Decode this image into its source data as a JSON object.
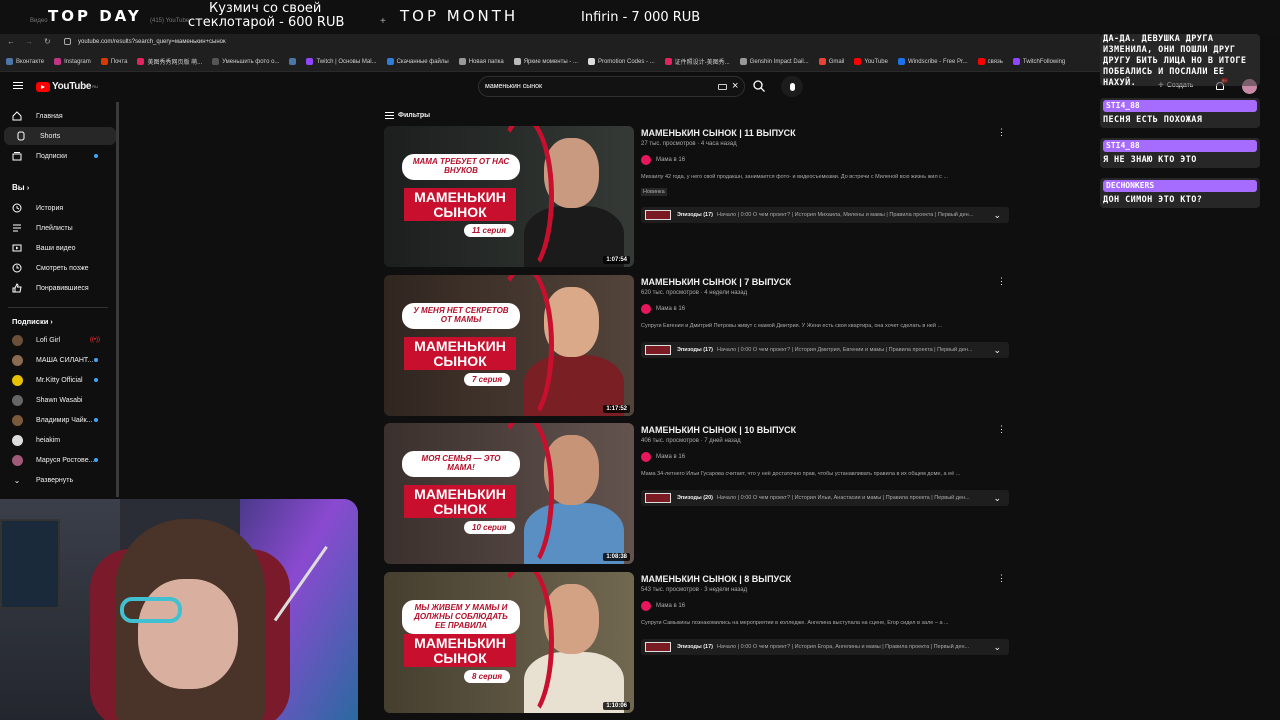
{
  "overlay": {
    "top_day": "TOP DAY",
    "donor_line1": "Кузмич со своей",
    "donor_line2": "стеклотарой - 600 RUB",
    "top_month": "TOP MONTH",
    "month_donor": "Infirin - 7 000 RUB"
  },
  "browser": {
    "tabs": [
      "Видео",
      "(415) YouTube",
      "..."
    ],
    "url": "youtube.com/results?search_query=маменькин+сынок",
    "bookmarks": [
      {
        "label": "Вконтакте",
        "color": "#4a76a8"
      },
      {
        "label": "Instagram",
        "color": "#c13584"
      },
      {
        "label": "Почта",
        "color": "#d83b01"
      },
      {
        "label": "美图秀秀网页版 萌...",
        "color": "#e0245e"
      },
      {
        "label": "Уменьшить фото о...",
        "color": "#555555"
      },
      {
        "label": "",
        "color": "#4a76a8"
      },
      {
        "label": "Twitch | Основы Маl...",
        "color": "#9146ff"
      },
      {
        "label": "Скачанные файлы",
        "color": "#2e7dd7"
      },
      {
        "label": "Новая папка",
        "color": "#999999"
      },
      {
        "label": "Яркие моменты - ...",
        "color": "#bbbbbb"
      },
      {
        "label": "Promotion Codes - ...",
        "color": "#dddddd"
      },
      {
        "label": "证件照设计-美图秀...",
        "color": "#e0245e"
      },
      {
        "label": "Genshin Impact Dail...",
        "color": "#999999"
      },
      {
        "label": "Gmail",
        "color": "#ea4335"
      },
      {
        "label": "YouTube",
        "color": "#ff0000"
      },
      {
        "label": "Windscribe - Free Pr...",
        "color": "#1a73e8"
      },
      {
        "label": "связь",
        "color": "#ff0000"
      },
      {
        "label": "TwitchFollowing",
        "color": "#9146ff"
      }
    ]
  },
  "youtube": {
    "logo": "YouTube",
    "logo_sup": "RU",
    "search_value": "маменькин сынок",
    "create_label": "Создать",
    "notif_count": "9+",
    "filters_label": "Фильтры"
  },
  "sidebar": {
    "main": [
      {
        "label": "Главная",
        "icon": "home-icon"
      },
      {
        "label": "Shorts",
        "icon": "shorts-icon"
      },
      {
        "label": "Подписки",
        "icon": "subscriptions-icon"
      }
    ],
    "you_label": "Вы",
    "you_items": [
      {
        "label": "История",
        "icon": "history-icon"
      },
      {
        "label": "Плейлисты",
        "icon": "playlists-icon"
      },
      {
        "label": "Ваши видео",
        "icon": "your-videos-icon"
      },
      {
        "label": "Смотреть позже",
        "icon": "watch-later-icon"
      },
      {
        "label": "Понравившиеся",
        "icon": "liked-icon"
      }
    ],
    "subs_label": "Подписки",
    "subs": [
      {
        "label": "Lofi Girl",
        "color": "#6b4f3a",
        "indicator": "live"
      },
      {
        "label": "МАША СИЛАНТ...",
        "color": "#8a6a50",
        "indicator": "dot"
      },
      {
        "label": "Mr.Kitty Official",
        "color": "#e6c200",
        "indicator": "dot"
      },
      {
        "label": "Shawn Wasabi",
        "color": "#666666",
        "indicator": "none"
      },
      {
        "label": "Владимир Чайк...",
        "color": "#7a5a3a",
        "indicator": "dot"
      },
      {
        "label": "heiakim",
        "color": "#dddddd",
        "indicator": "none"
      },
      {
        "label": "Маруся Ростове...",
        "color": "#a05a7a",
        "indicator": "dot"
      }
    ],
    "expand_label": "Развернуть"
  },
  "videos": [
    {
      "title": "МАМЕНЬКИН СЫНОК | 11 ВЫПУСК",
      "meta": "27 тыс. просмотров · 4 часа назад",
      "channel": "Мама в 16",
      "desc": "Михаилу 42 года, у него свой продакшн, занимается фото- и видеосъемками. До встречи с Миленой всю жизнь жил с ...",
      "badge": "Новинка",
      "episodes_label": "Эпизоды (17)",
      "episodes_text": "Начало | 0:00 О чем проект? | История Михаила, Милены и мамы | Правила проекта | Первый ден...",
      "duration": "1:07:54",
      "bubble": "МАМА ТРЕБУЕТ ОТ НАС ВНУКОВ",
      "series": "11 серия",
      "brand_line1": "МАМЕНЬКИН",
      "brand_line2": "СЫНОК",
      "bg": "#2a2f2c",
      "shirt": "#1b1b1b",
      "skin": "#c99a80"
    },
    {
      "title": "МАМЕНЬКИН СЫНОК | 7 ВЫПУСК",
      "meta": "620 тыс. просмотров · 4 недели назад",
      "channel": "Мама в 16",
      "desc": "Супруги Евгения и Дмитрий Петровы живут с мамой Дмитрия. У Жени есть своя квартира, она хочет сделать в ней ...",
      "badge": "",
      "episodes_label": "Эпизоды (17)",
      "episodes_text": "Начало | 0:00 О чем проект? | История Дмитрия, Евгении и мамы | Правила проекта | Первый ден...",
      "duration": "1:17:52",
      "bubble": "У МЕНЯ НЕТ СЕКРЕТОВ ОТ МАМЫ",
      "series": "7 серия",
      "brand_line1": "МАМЕНЬКИН",
      "brand_line2": "СЫНОК",
      "bg": "#4a3a30",
      "shirt": "#7a1f24",
      "skin": "#d9a98a"
    },
    {
      "title": "МАМЕНЬКИН СЫНОК | 10 ВЫПУСК",
      "meta": "406 тыс. просмотров · 7 дней назад",
      "channel": "Мама в 16",
      "desc": "Мама 34-летнего Ильи Гусарова считает, что у неё достаточно прав, чтобы устанавливать правила в их общем доме, а её ...",
      "badge": "",
      "episodes_label": "Эпизоды (20)",
      "episodes_text": "Начало | 0:00 О чем проект? | История Ильи, Анастасии и мамы | Правила проекта | Первый ден...",
      "duration": "1:08:38",
      "bubble": "МОЯ СЕМЬЯ — ЭТО МАМА!",
      "series": "10 серия",
      "brand_line1": "МАМЕНЬКИН",
      "brand_line2": "СЫНОК",
      "bg": "#5a4a45",
      "shirt": "#5a8fc4",
      "skin": "#c89478"
    },
    {
      "title": "МАМЕНЬКИН СЫНОК | 8 ВЫПУСК",
      "meta": "543 тыс. просмотров · 3 недели назад",
      "channel": "Мама в 16",
      "desc": "Супруги Самыкины познакомились на мероприятии в колледже. Ангелина выступала на сцене, Егор сидел в зале – а ...",
      "badge": "",
      "episodes_label": "Эпизоды (17)",
      "episodes_text": "Начало | 0:00 О чем проект? | История Егора, Ангелины и мамы | Правила проекта | Первый ден...",
      "duration": "1:10:06",
      "bubble": "МЫ ЖИВЕМ У МАМЫ И ДОЛЖНЫ СОБЛЮДАТЬ ЕЕ ПРАВИЛА",
      "series": "8 серия",
      "brand_line1": "МАМЕНЬКИН",
      "brand_line2": "СЫНОК",
      "bg": "#6a6048",
      "shirt": "#e8e0d0",
      "skin": "#d3a285"
    }
  ],
  "chat": [
    {
      "name": "",
      "lines": [
        "ДА-ДА. ДЕВУШКА ДРУГА",
        "ИЗМЕНИЛА, ОНИ ПОШЛИ ДРУГ",
        "ДРУГУ БИТЬ ЛИЦА НО В ИТОГЕ",
        "ПОБЕАЛИСЬ И ПОСЛАЛИ ЕЕ",
        "НАХУЙ."
      ]
    },
    {
      "name": "STI4_88",
      "lines": [
        "ПЕСНЯ ЕСТЬ ПОХОЖАЯ"
      ]
    },
    {
      "name": "STI4_88",
      "lines": [
        "Я НЕ ЗНАЮ КТО ЭТО"
      ]
    },
    {
      "name": "DECHONKERS",
      "lines": [
        "ДОН СИМОН ЭТО КТО?"
      ]
    }
  ]
}
